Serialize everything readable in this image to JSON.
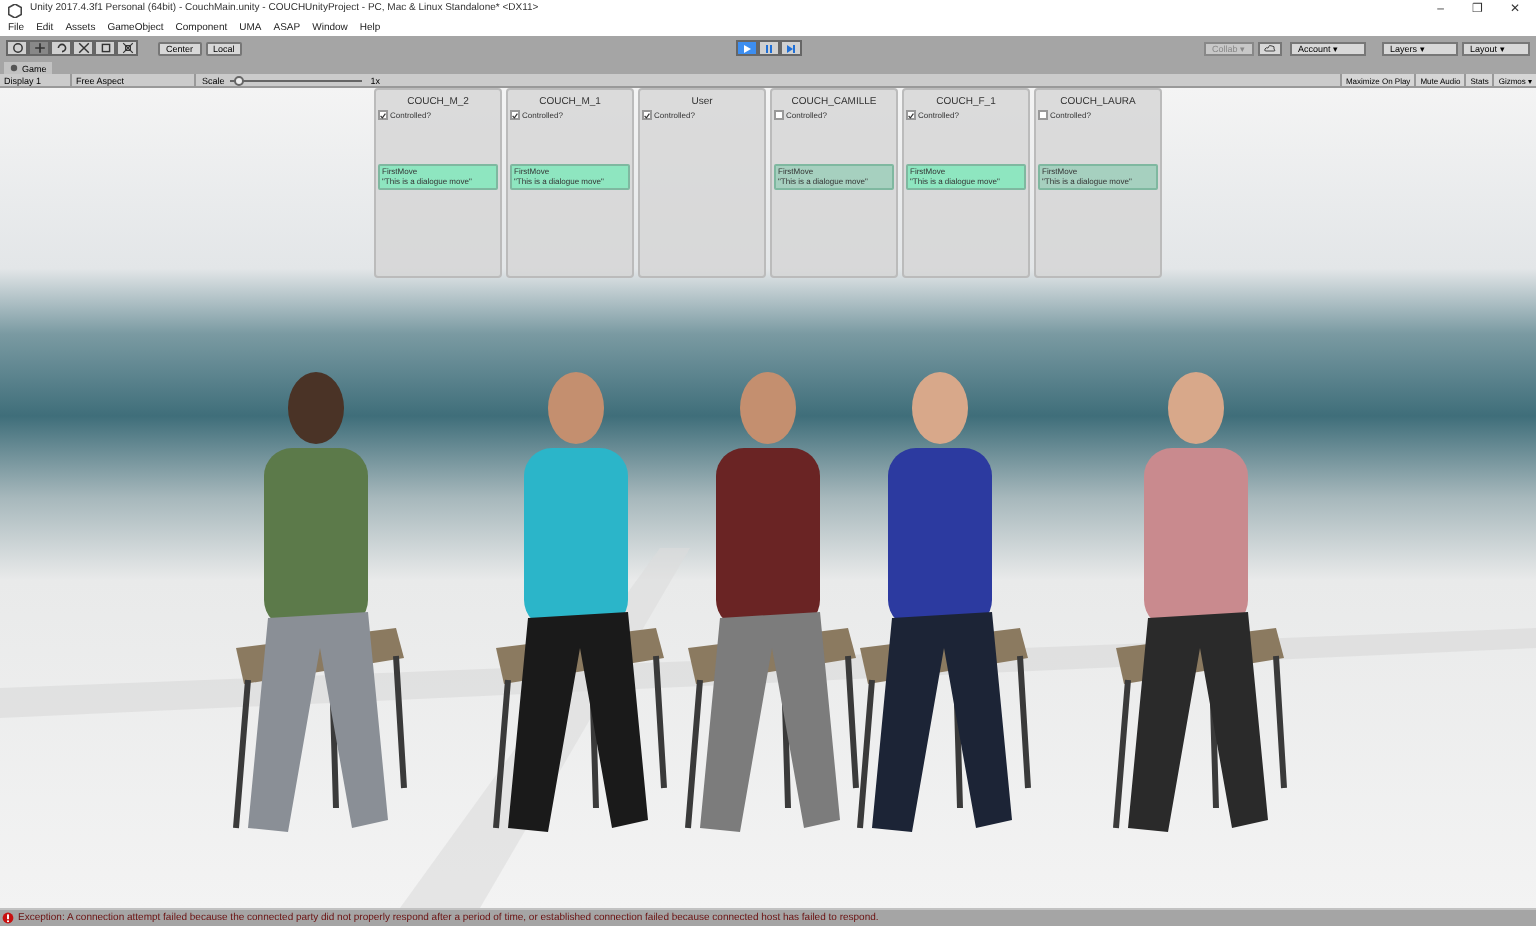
{
  "window": {
    "title": "Unity 2017.4.3f1 Personal (64bit) - CouchMain.unity - COUCHUnityProject - PC, Mac & Linux Standalone* <DX11>",
    "controls": [
      "–",
      "❐",
      "✕"
    ]
  },
  "menu": [
    "File",
    "Edit",
    "Assets",
    "GameObject",
    "Component",
    "UMA",
    "ASAP",
    "Window",
    "Help"
  ],
  "toolbar": {
    "pivot": "Center",
    "space": "Local",
    "playing": true,
    "collab": "Collab ▾",
    "account": "Account ▾",
    "layers": "Layers ▾",
    "layout": "Layout ▾"
  },
  "game_tab": {
    "title": "Game",
    "display": "Display 1",
    "aspect": "Free Aspect",
    "scale_label": "Scale",
    "scale": {
      "level": 0.03
    },
    "scale_value": "1x",
    "toggles": [
      "Maximize On Play",
      "Mute Audio",
      "Stats",
      "Gizmos ▾"
    ]
  },
  "panels": [
    {
      "name": "COUCH_M_2",
      "checkbox_label": "Controlled?",
      "controlled": true,
      "move_title": "FirstMove",
      "move_text": "\"This is a dialogue move\""
    },
    {
      "name": "COUCH_M_1",
      "checkbox_label": "Controlled?",
      "controlled": true,
      "move_title": "FirstMove",
      "move_text": "\"This is a dialogue move\""
    },
    {
      "name": "User",
      "checkbox_label": "Controlled?",
      "controlled": true
    },
    {
      "name": "COUCH_CAMILLE",
      "checkbox_label": "Controlled?",
      "controlled": false,
      "move_title": "FirstMove",
      "move_text": "\"This is a dialogue move\""
    },
    {
      "name": "COUCH_F_1",
      "checkbox_label": "Controlled?",
      "controlled": true,
      "move_title": "FirstMove",
      "move_text": "\"This is a dialogue move\""
    },
    {
      "name": "COUCH_LAURA",
      "checkbox_label": "Controlled?",
      "controlled": false,
      "move_title": "FirstMove",
      "move_text": "\"This is a dialogue move\""
    }
  ],
  "status_bar": {
    "kind": "error",
    "message": "Exception: A connection attempt failed because the connected party did not properly respond after a period of time, or established connection failed because connected host has failed to respond."
  }
}
